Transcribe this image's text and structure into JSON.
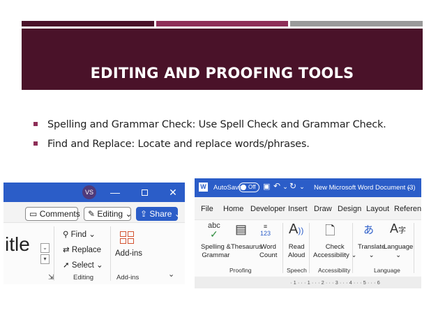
{
  "slide": {
    "title": "EDITING AND PROOFING TOOLS",
    "bullets": [
      "Spelling and Grammar Check: Use Spell Check and Grammar Check.",
      "Find and Replace: Locate and replace words/phrases."
    ],
    "colors": {
      "banner": "#4a1229",
      "accent_bar": "#8e2f58",
      "gray_bar": "#9a9a9a",
      "word_blue": "#2b5dc8"
    }
  },
  "left_screenshot": {
    "avatar_initials": "VS",
    "window_controls": {
      "minimize": "—",
      "close": "✕"
    },
    "comments_label": "Comments",
    "editing_label": "Editing",
    "share_label": "Share",
    "style_text": "itle",
    "editing_group": {
      "find": "Find",
      "replace": "Replace",
      "select": "Select",
      "label": "Editing"
    },
    "addins_group": {
      "button": "Add-ins",
      "label": "Add-ins"
    }
  },
  "right_screenshot": {
    "autosave_label": "AutoSave",
    "autosave_state": "Off",
    "document_title": "New Microsoft Word Document (3)",
    "menu": [
      "File",
      "Home",
      "Developer",
      "Insert",
      "Draw",
      "Design",
      "Layout",
      "Referenc"
    ],
    "tools": {
      "spelling_line1": "Spelling &",
      "spelling_line2": "Grammar",
      "thesaurus": "Thesaurus",
      "word_count_line1": "Word",
      "word_count_line2": "Count",
      "read_aloud_line1": "Read",
      "read_aloud_line2": "Aloud",
      "check_acc_line1": "Check",
      "check_acc_line2": "Accessibility",
      "translate": "Translate",
      "language": "Language"
    },
    "groups": {
      "proofing": "Proofing",
      "speech": "Speech",
      "accessibility": "Accessibility",
      "language": "Language"
    },
    "icon_text": {
      "abc": "abc",
      "count": "123"
    },
    "ruler": "· 1 · · · 1 · · · 2 · · · 3 · · · 4 · · · 5 · · · 6"
  }
}
